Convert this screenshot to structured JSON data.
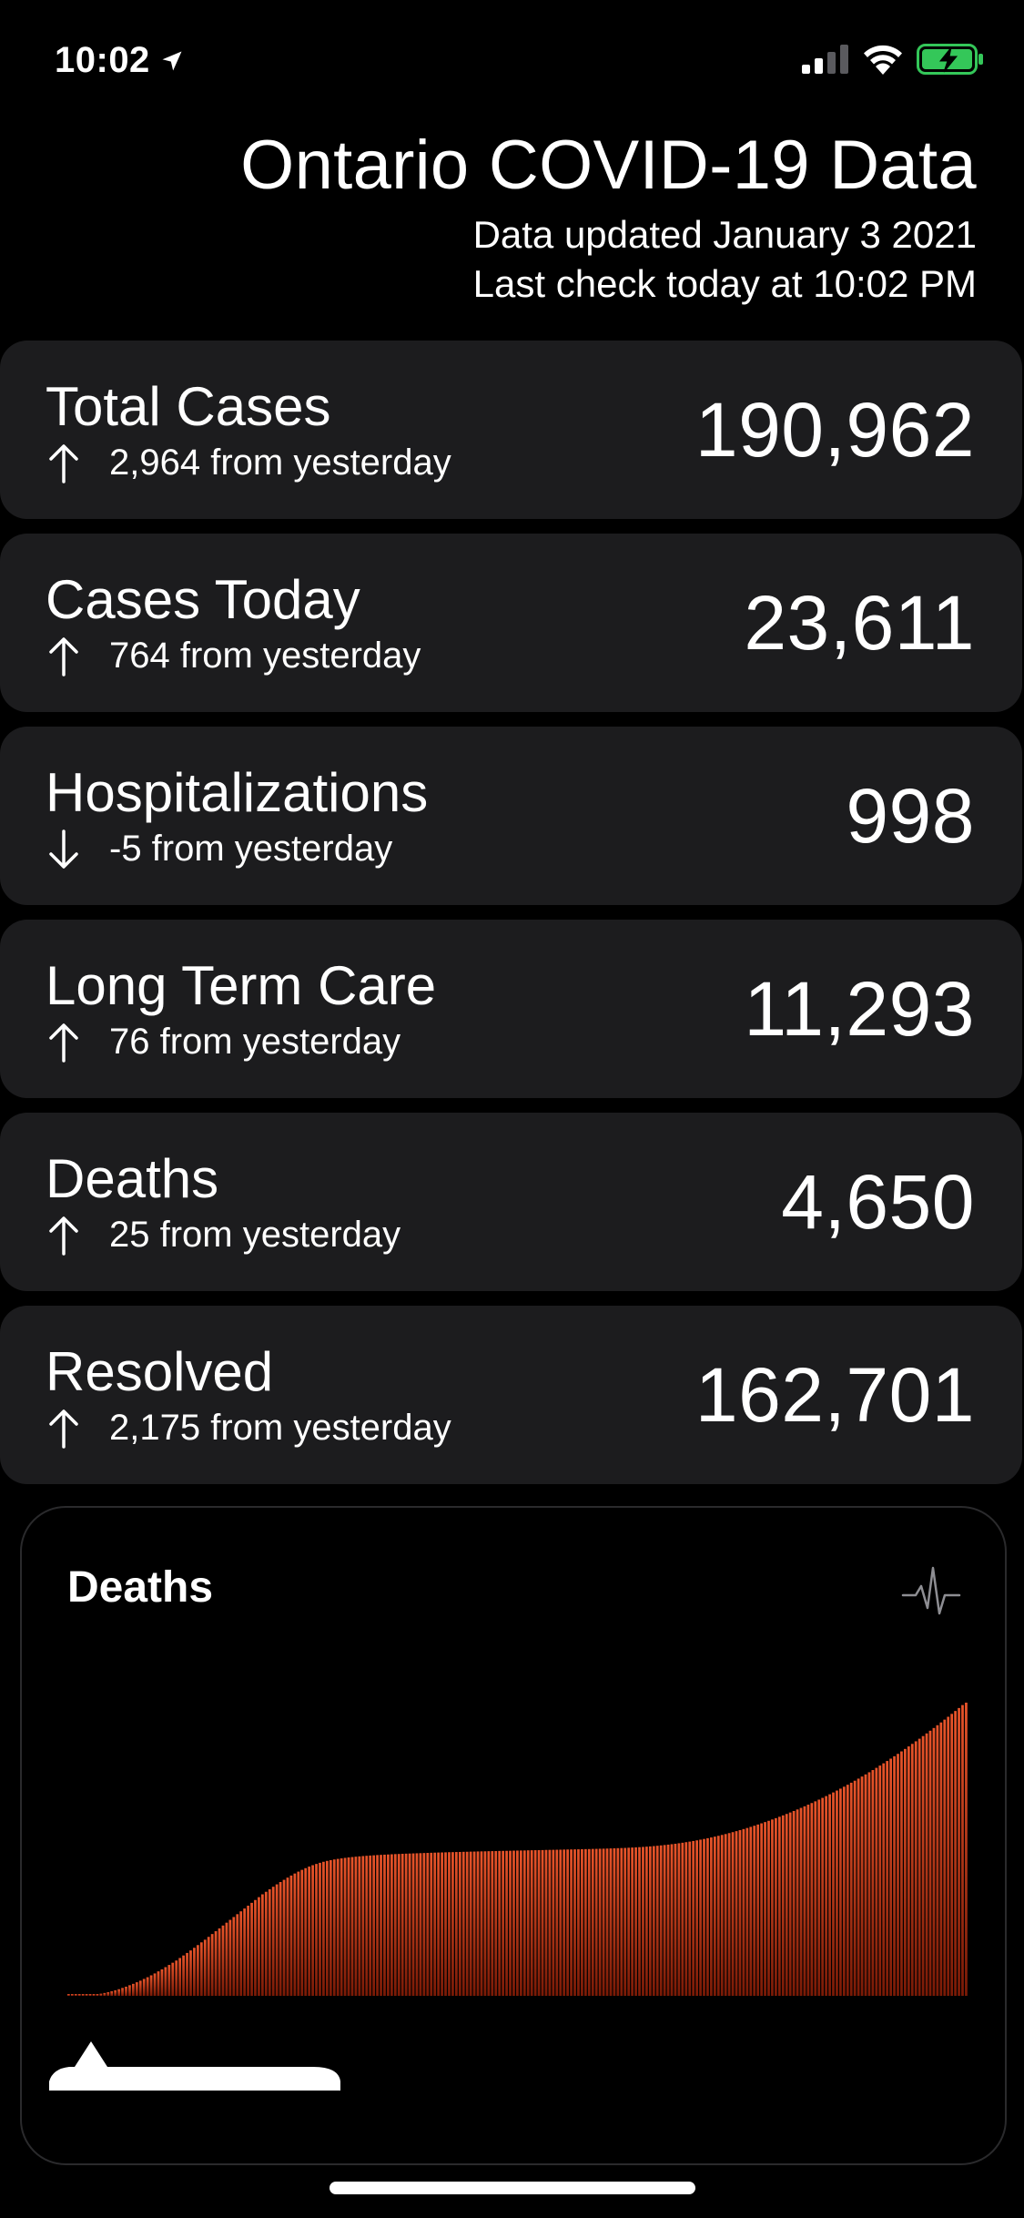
{
  "status_bar": {
    "time": "10:02",
    "icons": [
      "location-arrow-icon",
      "cellular-signal-icon",
      "wifi-icon",
      "battery-charging-icon"
    ],
    "battery_color": "#34c759"
  },
  "header": {
    "title": "Ontario COVID-19 Data",
    "updated": "Data updated January 3 2021",
    "last_check": "Last check today at 10:02 PM"
  },
  "stats": [
    {
      "label": "Total Cases",
      "delta": "2,964 from yesterday",
      "direction": "up",
      "value": "190,962"
    },
    {
      "label": "Cases Today",
      "delta": "764 from yesterday",
      "direction": "up",
      "value": "23,611"
    },
    {
      "label": "Hospitalizations",
      "delta": "-5 from yesterday",
      "direction": "down",
      "value": "998"
    },
    {
      "label": "Long Term Care",
      "delta": "76 from yesterday",
      "direction": "up",
      "value": "11,293"
    },
    {
      "label": "Deaths",
      "delta": "25 from yesterday",
      "direction": "up",
      "value": "4,650"
    },
    {
      "label": "Resolved",
      "delta": "2,175 from yesterday",
      "direction": "up",
      "value": "162,701"
    }
  ],
  "chart_widget": {
    "title": "Deaths",
    "icon": "pulse-waveform-icon",
    "bar_color_top": "#e8542a",
    "bar_color_bottom": "#7a1a06",
    "chart_data": {
      "type": "bar",
      "title": "Deaths",
      "series": [
        {
          "values": [
            1,
            2,
            3,
            4,
            6,
            8,
            12,
            18,
            25,
            34,
            45,
            57,
            72,
            88,
            105,
            125,
            145,
            168,
            190,
            215,
            240,
            268,
            295,
            325,
            355,
            388,
            420,
            455,
            490,
            525,
            560,
            600,
            640,
            680,
            720,
            762,
            805,
            848,
            890,
            935,
            980,
            1025,
            1070,
            1115,
            1160,
            1205,
            1250,
            1295,
            1340,
            1385,
            1430,
            1475,
            1520,
            1565,
            1610,
            1650,
            1690,
            1730,
            1768,
            1805,
            1840,
            1875,
            1908,
            1940,
            1970,
            1998,
            2025,
            2050,
            2072,
            2092,
            2110,
            2126,
            2140,
            2152,
            2163,
            2172,
            2180,
            2188,
            2195,
            2201,
            2207,
            2212,
            2217,
            2221,
            2225,
            2229,
            2233,
            2236,
            2239,
            2242,
            2245,
            2248,
            2250,
            2253,
            2255,
            2257,
            2259,
            2261,
            2263,
            2265,
            2267,
            2269,
            2271,
            2273,
            2274,
            2276,
            2278,
            2279,
            2281,
            2282,
            2284,
            2285,
            2287,
            2288,
            2290,
            2291,
            2292,
            2294,
            2295,
            2296,
            2298,
            2299,
            2300,
            2301,
            2303,
            2304,
            2305,
            2306,
            2308,
            2309,
            2310,
            2311,
            2312,
            2314,
            2315,
            2316,
            2317,
            2318,
            2320,
            2321,
            2322,
            2323,
            2324,
            2326,
            2327,
            2328,
            2330,
            2331,
            2333,
            2334,
            2336,
            2338,
            2340,
            2342,
            2344,
            2346,
            2349,
            2352,
            2355,
            2358,
            2362,
            2366,
            2370,
            2375,
            2380,
            2386,
            2392,
            2398,
            2405,
            2412,
            2420,
            2428,
            2437,
            2446,
            2456,
            2466,
            2477,
            2488,
            2500,
            2512,
            2525,
            2538,
            2552,
            2566,
            2581,
            2596,
            2612,
            2628,
            2645,
            2662,
            2680,
            2698,
            2717,
            2736,
            2756,
            2776,
            2797,
            2818,
            2840,
            2862,
            2885,
            2908,
            2932,
            2956,
            2981,
            3006,
            3032,
            3058,
            3085,
            3112,
            3140,
            3168,
            3197,
            3226,
            3256,
            3286,
            3317,
            3348,
            3380,
            3412,
            3445,
            3478,
            3512,
            3546,
            3581,
            3616,
            3652,
            3688,
            3725,
            3762,
            3800,
            3838,
            3877,
            3916,
            3956,
            3996,
            4037,
            4078,
            4120,
            4162,
            4205,
            4248,
            4292,
            4336,
            4381,
            4426,
            4472,
            4518,
            4565,
            4612,
            4650
          ]
        }
      ]
    }
  },
  "colors": {
    "background": "#000000",
    "card": "#1c1c1e",
    "text": "#ffffff"
  }
}
